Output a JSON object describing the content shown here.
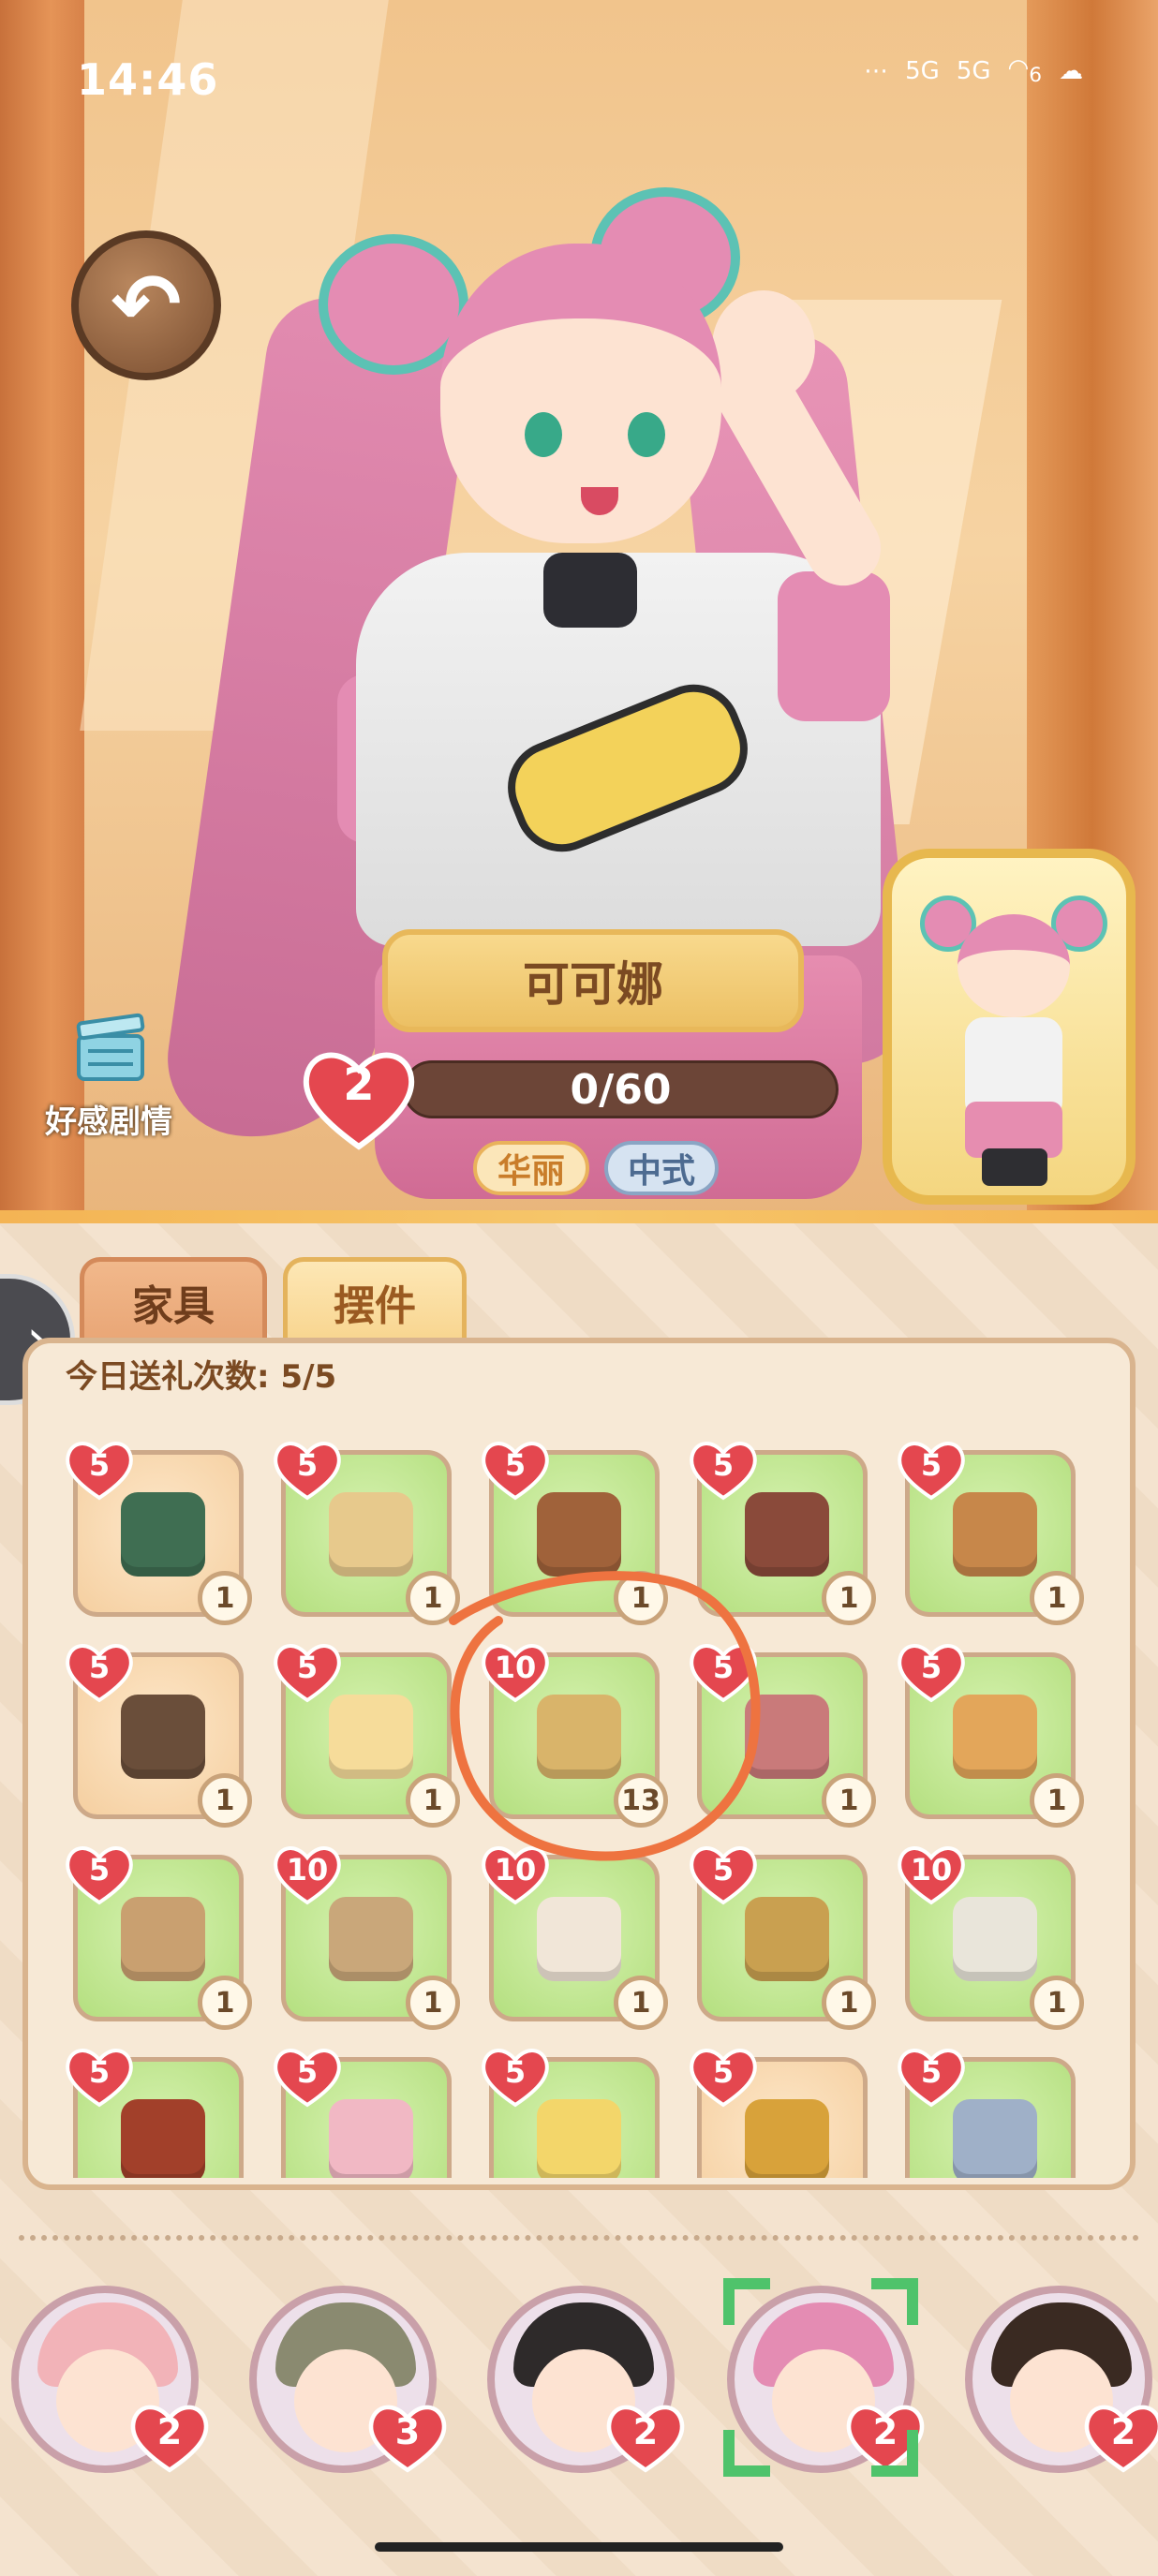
{
  "status_bar": {
    "time": "14:46",
    "extra": "⋯",
    "signal1": "5G",
    "signal2": "5G",
    "wifi_num": "6"
  },
  "character": {
    "name": "可可娜",
    "affection_level": "2",
    "affection_progress": "0/60",
    "tags": [
      "华丽",
      "中式"
    ]
  },
  "story_button": {
    "label": "好感剧情"
  },
  "tabs": [
    {
      "label": "家具",
      "active": true
    },
    {
      "label": "摆件",
      "active": false
    }
  ],
  "gift_count_label": "今日送礼次数: 5/5",
  "items": [
    {
      "heart": "5",
      "qty": "1",
      "bg": "peach",
      "icon": "books-icon",
      "color": "#3f6e52"
    },
    {
      "heart": "5",
      "qty": "1",
      "bg": "green",
      "icon": "lantern-icon",
      "color": "#e7c98c"
    },
    {
      "heart": "5",
      "qty": "1",
      "bg": "green",
      "icon": "briefcase-icon",
      "color": "#a0623a"
    },
    {
      "heart": "5",
      "qty": "1",
      "bg": "green",
      "icon": "handbag-icon",
      "color": "#8a4a3a"
    },
    {
      "heart": "5",
      "qty": "1",
      "bg": "green",
      "icon": "box-icon",
      "color": "#c7874a"
    },
    {
      "heart": "5",
      "qty": "1",
      "bg": "peach",
      "icon": "purse-icon",
      "color": "#6a4e3a"
    },
    {
      "heart": "5",
      "qty": "1",
      "bg": "green",
      "icon": "bear-plate-icon",
      "color": "#f6dc9a"
    },
    {
      "heart": "10",
      "qty": "13",
      "bg": "green",
      "icon": "mirror-icon",
      "color": "#d9b46a"
    },
    {
      "heart": "5",
      "qty": "1",
      "bg": "green",
      "icon": "eyeshadow-palette-icon",
      "color": "#c97a7a"
    },
    {
      "heart": "5",
      "qty": "1",
      "bg": "green",
      "icon": "wicker-bag-icon",
      "color": "#e3a65a"
    },
    {
      "heart": "5",
      "qty": "1",
      "bg": "green",
      "icon": "yarn-basket-icon",
      "color": "#c9a070"
    },
    {
      "heart": "10",
      "qty": "1",
      "bg": "green",
      "icon": "clutch-bag-icon",
      "color": "#c9a77a"
    },
    {
      "heart": "10",
      "qty": "1",
      "bg": "green",
      "icon": "necklace-stand-icon",
      "color": "#f1e6d8"
    },
    {
      "heart": "5",
      "qty": "1",
      "bg": "green",
      "icon": "glasses-icon",
      "color": "#c9a050"
    },
    {
      "heart": "10",
      "qty": "1",
      "bg": "green",
      "icon": "slippers-icon",
      "color": "#e9e5da"
    },
    {
      "heart": "5",
      "qty": "",
      "bg": "green",
      "icon": "red-books-icon",
      "color": "#a2402a"
    },
    {
      "heart": "5",
      "qty": "",
      "bg": "green",
      "icon": "cup-icon",
      "color": "#f1b8c4"
    },
    {
      "heart": "5",
      "qty": "",
      "bg": "green",
      "icon": "gift-box-icon",
      "color": "#f3d66a"
    },
    {
      "heart": "5",
      "qty": "",
      "bg": "peach",
      "icon": "brush-icon",
      "color": "#d8a23a"
    },
    {
      "heart": "5",
      "qty": "",
      "bg": "green",
      "icon": "cream-jar-icon",
      "color": "#9fb0c8"
    }
  ],
  "characters_bar": [
    {
      "level": "2",
      "hair": "#f2b3b8",
      "selected": false
    },
    {
      "level": "3",
      "hair": "#8a8a70",
      "selected": false
    },
    {
      "level": "2",
      "hair": "#2e2a2a",
      "selected": false
    },
    {
      "level": "2",
      "hair": "#e48cb3",
      "selected": true
    },
    {
      "level": "2",
      "hair": "#3a2a22",
      "selected": false
    }
  ],
  "colors": {
    "heart": "#e4474f",
    "annotation": "#ee7340",
    "select_frame": "#4fc36b"
  }
}
